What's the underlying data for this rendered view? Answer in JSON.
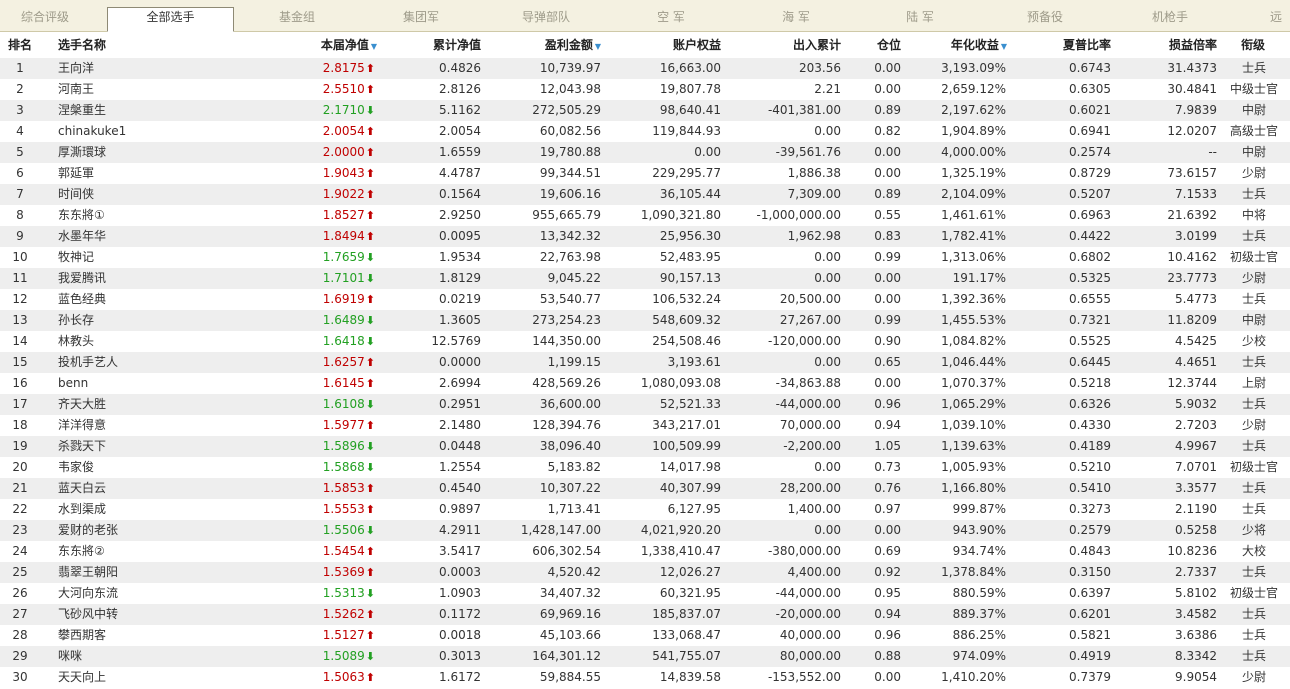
{
  "tabs": [
    {
      "label": "综合评级",
      "active": false
    },
    {
      "label": "全部选手",
      "active": true
    },
    {
      "label": "基金组",
      "active": false
    },
    {
      "label": "集团军",
      "active": false
    },
    {
      "label": "导弹部队",
      "active": false
    },
    {
      "label": "空 军",
      "active": false
    },
    {
      "label": "海 军",
      "active": false
    },
    {
      "label": "陆 军",
      "active": false
    },
    {
      "label": "预备役",
      "active": false
    },
    {
      "label": "机枪手",
      "active": false
    },
    {
      "label": "远",
      "active": false
    }
  ],
  "columns": {
    "rank": "排名",
    "name": "选手名称",
    "nav": "本届净值",
    "cum_nav": "累计净值",
    "profit": "盈利金额",
    "equity": "账户权益",
    "flow": "出入累计",
    "position": "仓位",
    "annual": "年化收益",
    "sharpe": "夏普比率",
    "pl_ratio": "损益倍率",
    "level": "衔级"
  },
  "sort_indicator_icon": "sort-down-triangle-icon",
  "colors": {
    "up": "#c00000",
    "down": "#22a022",
    "sort": "#3a8fcf",
    "tab_bar": "#f4f1e1",
    "row_alt": "#eeeeee"
  },
  "rows": [
    {
      "rank": "1",
      "name": "王向洋",
      "nav": "2.8175",
      "dir": "up",
      "cum_nav": "0.4826",
      "profit": "10,739.97",
      "equity": "16,663.00",
      "flow": "203.56",
      "position": "0.00",
      "annual": "3,193.09%",
      "sharpe": "0.6743",
      "pl_ratio": "31.4373",
      "level": "士兵"
    },
    {
      "rank": "2",
      "name": "河南王",
      "nav": "2.5510",
      "dir": "up",
      "cum_nav": "2.8126",
      "profit": "12,043.98",
      "equity": "19,807.78",
      "flow": "2.21",
      "position": "0.00",
      "annual": "2,659.12%",
      "sharpe": "0.6305",
      "pl_ratio": "30.4841",
      "level": "中级士官"
    },
    {
      "rank": "3",
      "name": "涅槃重生",
      "nav": "2.1710",
      "dir": "down",
      "cum_nav": "5.1162",
      "profit": "272,505.29",
      "equity": "98,640.41",
      "flow": "-401,381.00",
      "position": "0.89",
      "annual": "2,197.62%",
      "sharpe": "0.6021",
      "pl_ratio": "7.9839",
      "level": "中尉"
    },
    {
      "rank": "4",
      "name": "chinakuke1",
      "nav": "2.0054",
      "dir": "up",
      "cum_nav": "2.0054",
      "profit": "60,082.56",
      "equity": "119,844.93",
      "flow": "0.00",
      "position": "0.82",
      "annual": "1,904.89%",
      "sharpe": "0.6941",
      "pl_ratio": "12.0207",
      "level": "高级士官"
    },
    {
      "rank": "5",
      "name": "厚澌環球",
      "nav": "2.0000",
      "dir": "up",
      "cum_nav": "1.6559",
      "profit": "19,780.88",
      "equity": "0.00",
      "flow": "-39,561.76",
      "position": "0.00",
      "annual": "4,000.00%",
      "sharpe": "0.2574",
      "pl_ratio": "--",
      "level": "中尉"
    },
    {
      "rank": "6",
      "name": "郭延軍",
      "nav": "1.9043",
      "dir": "up",
      "cum_nav": "4.4787",
      "profit": "99,344.51",
      "equity": "229,295.77",
      "flow": "1,886.38",
      "position": "0.00",
      "annual": "1,325.19%",
      "sharpe": "0.8729",
      "pl_ratio": "73.6157",
      "level": "少尉"
    },
    {
      "rank": "7",
      "name": "时间侠",
      "nav": "1.9022",
      "dir": "up",
      "cum_nav": "0.1564",
      "profit": "19,606.16",
      "equity": "36,105.44",
      "flow": "7,309.00",
      "position": "0.89",
      "annual": "2,104.09%",
      "sharpe": "0.5207",
      "pl_ratio": "7.1533",
      "level": "士兵"
    },
    {
      "rank": "8",
      "name": "东东將①",
      "nav": "1.8527",
      "dir": "up",
      "cum_nav": "2.9250",
      "profit": "955,665.79",
      "equity": "1,090,321.80",
      "flow": "-1,000,000.00",
      "position": "0.55",
      "annual": "1,461.61%",
      "sharpe": "0.6963",
      "pl_ratio": "21.6392",
      "level": "中将"
    },
    {
      "rank": "9",
      "name": "水墨年华",
      "nav": "1.8494",
      "dir": "up",
      "cum_nav": "0.0095",
      "profit": "13,342.32",
      "equity": "25,956.30",
      "flow": "1,962.98",
      "position": "0.83",
      "annual": "1,782.41%",
      "sharpe": "0.4422",
      "pl_ratio": "3.0199",
      "level": "士兵"
    },
    {
      "rank": "10",
      "name": "牧神记",
      "nav": "1.7659",
      "dir": "down",
      "cum_nav": "1.9534",
      "profit": "22,763.98",
      "equity": "52,483.95",
      "flow": "0.00",
      "position": "0.99",
      "annual": "1,313.06%",
      "sharpe": "0.6802",
      "pl_ratio": "10.4162",
      "level": "初级士官"
    },
    {
      "rank": "11",
      "name": "我爱腾讯",
      "nav": "1.7101",
      "dir": "down",
      "cum_nav": "1.8129",
      "profit": "9,045.22",
      "equity": "90,157.13",
      "flow": "0.00",
      "position": "0.00",
      "annual": "191.17%",
      "sharpe": "0.5325",
      "pl_ratio": "23.7773",
      "level": "少尉"
    },
    {
      "rank": "12",
      "name": "蓝色经典",
      "nav": "1.6919",
      "dir": "up",
      "cum_nav": "0.0219",
      "profit": "53,540.77",
      "equity": "106,532.24",
      "flow": "20,500.00",
      "position": "0.00",
      "annual": "1,392.36%",
      "sharpe": "0.6555",
      "pl_ratio": "5.4773",
      "level": "士兵"
    },
    {
      "rank": "13",
      "name": "孙长存",
      "nav": "1.6489",
      "dir": "down",
      "cum_nav": "1.3605",
      "profit": "273,254.23",
      "equity": "548,609.32",
      "flow": "27,267.00",
      "position": "0.99",
      "annual": "1,455.53%",
      "sharpe": "0.7321",
      "pl_ratio": "11.8209",
      "level": "中尉"
    },
    {
      "rank": "14",
      "name": "林教头",
      "nav": "1.6418",
      "dir": "down",
      "cum_nav": "12.5769",
      "profit": "144,350.00",
      "equity": "254,508.46",
      "flow": "-120,000.00",
      "position": "0.90",
      "annual": "1,084.82%",
      "sharpe": "0.5525",
      "pl_ratio": "4.5425",
      "level": "少校"
    },
    {
      "rank": "15",
      "name": "投机手艺人",
      "nav": "1.6257",
      "dir": "up",
      "cum_nav": "0.0000",
      "profit": "1,199.15",
      "equity": "3,193.61",
      "flow": "0.00",
      "position": "0.65",
      "annual": "1,046.44%",
      "sharpe": "0.6445",
      "pl_ratio": "4.4651",
      "level": "士兵"
    },
    {
      "rank": "16",
      "name": "benn",
      "nav": "1.6145",
      "dir": "up",
      "cum_nav": "2.6994",
      "profit": "428,569.26",
      "equity": "1,080,093.08",
      "flow": "-34,863.88",
      "position": "0.00",
      "annual": "1,070.37%",
      "sharpe": "0.5218",
      "pl_ratio": "12.3744",
      "level": "上尉"
    },
    {
      "rank": "17",
      "name": "齐天大胜",
      "nav": "1.6108",
      "dir": "down",
      "cum_nav": "0.2951",
      "profit": "36,600.00",
      "equity": "52,521.33",
      "flow": "-44,000.00",
      "position": "0.96",
      "annual": "1,065.29%",
      "sharpe": "0.6326",
      "pl_ratio": "5.9032",
      "level": "士兵"
    },
    {
      "rank": "18",
      "name": "洋洋得意",
      "nav": "1.5977",
      "dir": "up",
      "cum_nav": "2.1480",
      "profit": "128,394.76",
      "equity": "343,217.01",
      "flow": "70,000.00",
      "position": "0.94",
      "annual": "1,039.10%",
      "sharpe": "0.4330",
      "pl_ratio": "2.7203",
      "level": "少尉"
    },
    {
      "rank": "19",
      "name": "杀戮天下",
      "nav": "1.5896",
      "dir": "down",
      "cum_nav": "0.0448",
      "profit": "38,096.40",
      "equity": "100,509.99",
      "flow": "-2,200.00",
      "position": "1.05",
      "annual": "1,139.63%",
      "sharpe": "0.4189",
      "pl_ratio": "4.9967",
      "level": "士兵"
    },
    {
      "rank": "20",
      "name": "韦家俊",
      "nav": "1.5868",
      "dir": "down",
      "cum_nav": "1.2554",
      "profit": "5,183.82",
      "equity": "14,017.98",
      "flow": "0.00",
      "position": "0.73",
      "annual": "1,005.93%",
      "sharpe": "0.5210",
      "pl_ratio": "7.0701",
      "level": "初级士官"
    },
    {
      "rank": "21",
      "name": "蓝天白云",
      "nav": "1.5853",
      "dir": "up",
      "cum_nav": "0.4540",
      "profit": "10,307.22",
      "equity": "40,307.99",
      "flow": "28,200.00",
      "position": "0.76",
      "annual": "1,166.80%",
      "sharpe": "0.5410",
      "pl_ratio": "3.3577",
      "level": "士兵"
    },
    {
      "rank": "22",
      "name": "水到渠成",
      "nav": "1.5553",
      "dir": "up",
      "cum_nav": "0.9897",
      "profit": "1,713.41",
      "equity": "6,127.95",
      "flow": "1,400.00",
      "position": "0.97",
      "annual": "999.87%",
      "sharpe": "0.3273",
      "pl_ratio": "2.1190",
      "level": "士兵"
    },
    {
      "rank": "23",
      "name": "爱财的老张",
      "nav": "1.5506",
      "dir": "down",
      "cum_nav": "4.2911",
      "profit": "1,428,147.00",
      "equity": "4,021,920.20",
      "flow": "0.00",
      "position": "0.00",
      "annual": "943.90%",
      "sharpe": "0.2579",
      "pl_ratio": "0.5258",
      "level": "少将"
    },
    {
      "rank": "24",
      "name": "东东將②",
      "nav": "1.5454",
      "dir": "up",
      "cum_nav": "3.5417",
      "profit": "606,302.54",
      "equity": "1,338,410.47",
      "flow": "-380,000.00",
      "position": "0.69",
      "annual": "934.74%",
      "sharpe": "0.4843",
      "pl_ratio": "10.8236",
      "level": "大校"
    },
    {
      "rank": "25",
      "name": "翡翠王朝阳",
      "nav": "1.5369",
      "dir": "up",
      "cum_nav": "0.0003",
      "profit": "4,520.42",
      "equity": "12,026.27",
      "flow": "4,400.00",
      "position": "0.92",
      "annual": "1,378.84%",
      "sharpe": "0.3150",
      "pl_ratio": "2.7337",
      "level": "士兵"
    },
    {
      "rank": "26",
      "name": "大河向东流",
      "nav": "1.5313",
      "dir": "down",
      "cum_nav": "1.0903",
      "profit": "34,407.32",
      "equity": "60,321.95",
      "flow": "-44,000.00",
      "position": "0.95",
      "annual": "880.59%",
      "sharpe": "0.6397",
      "pl_ratio": "5.8102",
      "level": "初级士官"
    },
    {
      "rank": "27",
      "name": "飞砂风中转",
      "nav": "1.5262",
      "dir": "up",
      "cum_nav": "0.1172",
      "profit": "69,969.16",
      "equity": "185,837.07",
      "flow": "-20,000.00",
      "position": "0.94",
      "annual": "889.37%",
      "sharpe": "0.6201",
      "pl_ratio": "3.4582",
      "level": "士兵"
    },
    {
      "rank": "28",
      "name": "攀西期客",
      "nav": "1.5127",
      "dir": "up",
      "cum_nav": "0.0018",
      "profit": "45,103.66",
      "equity": "133,068.47",
      "flow": "40,000.00",
      "position": "0.96",
      "annual": "886.25%",
      "sharpe": "0.5821",
      "pl_ratio": "3.6386",
      "level": "士兵"
    },
    {
      "rank": "29",
      "name": "咪咪",
      "nav": "1.5089",
      "dir": "down",
      "cum_nav": "0.3013",
      "profit": "164,301.12",
      "equity": "541,755.07",
      "flow": "80,000.00",
      "position": "0.88",
      "annual": "974.09%",
      "sharpe": "0.4919",
      "pl_ratio": "8.3342",
      "level": "士兵"
    },
    {
      "rank": "30",
      "name": "天天向上",
      "nav": "1.5063",
      "dir": "up",
      "cum_nav": "1.6172",
      "profit": "59,884.55",
      "equity": "14,839.58",
      "flow": "-153,552.00",
      "position": "0.00",
      "annual": "1,410.20%",
      "sharpe": "0.7379",
      "pl_ratio": "9.9054",
      "level": "少尉"
    }
  ]
}
